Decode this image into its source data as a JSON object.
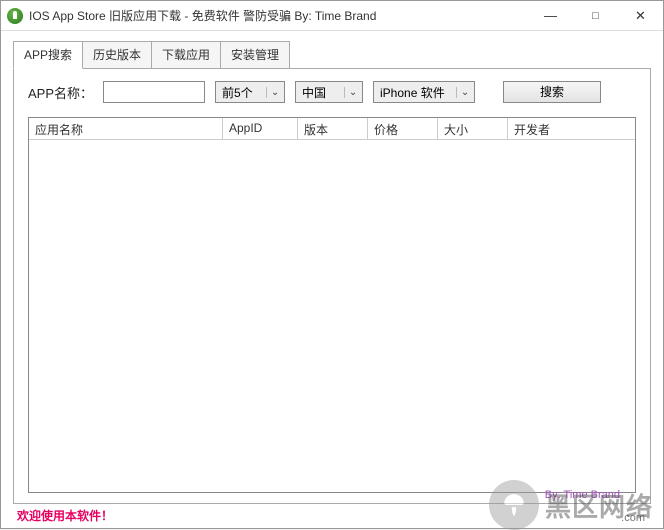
{
  "titlebar": {
    "title": "IOS App Store 旧版应用下载 - 免费软件 警防受骗 By: Time Brand",
    "min": "—",
    "max": "□",
    "close": "✕"
  },
  "tabs": {
    "items": [
      {
        "label": "APP搜索",
        "active": true
      },
      {
        "label": "历史版本",
        "active": false
      },
      {
        "label": "下载应用",
        "active": false
      },
      {
        "label": "安装管理",
        "active": false
      }
    ]
  },
  "search": {
    "label": "APP名称：",
    "input_value": "",
    "count_combo": "前5个",
    "region_combo": "中国",
    "device_combo": "iPhone 软件",
    "button": "搜索"
  },
  "grid": {
    "columns": {
      "name": "应用名称",
      "appid": "AppID",
      "version": "版本",
      "price": "价格",
      "size": "大小",
      "developer": "开发者"
    },
    "rows": []
  },
  "footer": {
    "welcome": "欢迎使用本软件！",
    "byline": "By: Time Brand",
    "watermark_text": "黑区网络",
    "watermark_sub": ".com"
  }
}
